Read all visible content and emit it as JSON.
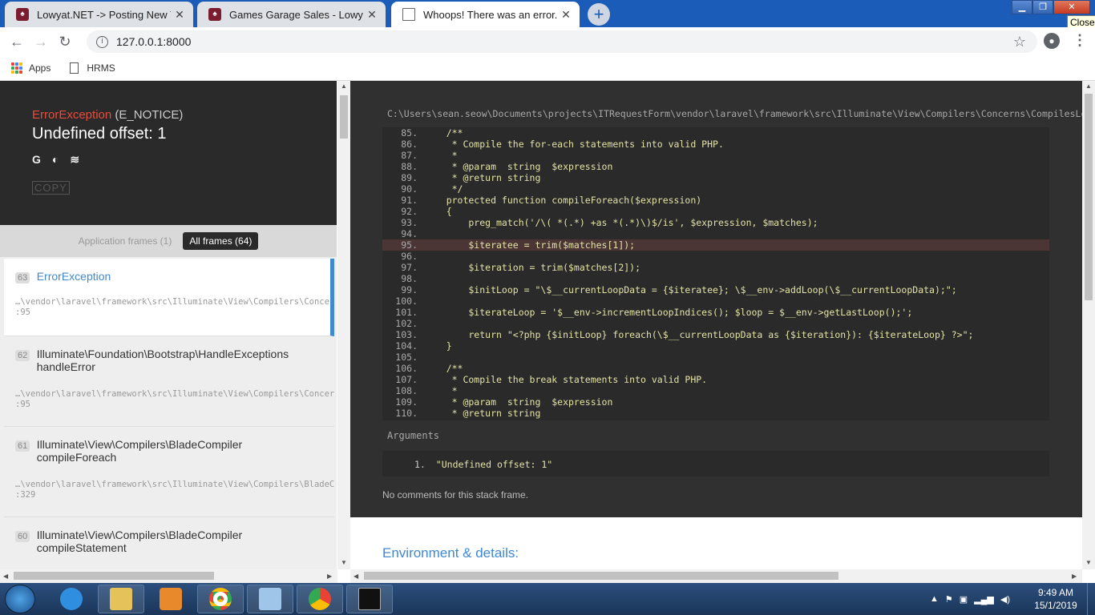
{
  "browser": {
    "tabs": [
      {
        "title": "Lowyat.NET -> Posting New Topi",
        "favicon": "lowyat-icon"
      },
      {
        "title": "Games Garage Sales - Lowyat.NE",
        "favicon": "lowyat-icon"
      },
      {
        "title": "Whoops! There was an error.",
        "favicon": "document-icon"
      }
    ],
    "close_tooltip": "Close",
    "address": "127.0.0.1:8000",
    "bookmarks": [
      {
        "label": "Apps",
        "icon": "apps-grid-icon"
      },
      {
        "label": "HRMS",
        "icon": "page-icon"
      }
    ]
  },
  "error": {
    "class": "ErrorException",
    "level": "(E_NOTICE)",
    "message": "Undefined offset: 1",
    "copy_label": "COPY",
    "filters": {
      "application": "Application frames (1)",
      "all": "All frames (64)"
    }
  },
  "frames": [
    {
      "num": "63",
      "class": "ErrorException",
      "method": "",
      "path": "…\\vendor\\laravel\\framework\\src\\Illuminate\\View\\Compilers\\Concerns\\CompilesLoops.php",
      "line": ":95"
    },
    {
      "num": "62",
      "class": "Illuminate\\Foundation\\Bootstrap\\HandleExceptions",
      "method": "handleError",
      "path": "…\\vendor\\laravel\\framework\\src\\Illuminate\\View\\Compilers\\Concerns\\CompilesLoops.php",
      "line": ":95"
    },
    {
      "num": "61",
      "class": "Illuminate\\View\\Compilers\\BladeCompiler",
      "method": "compileForeach",
      "path": "…\\vendor\\laravel\\framework\\src\\Illuminate\\View\\Compilers\\BladeCompiler.php",
      "line": ":329"
    },
    {
      "num": "60",
      "class": "Illuminate\\View\\Compilers\\BladeCompiler",
      "method": "compileStatement",
      "path": "",
      "line": ""
    }
  ],
  "source": {
    "file": "C:\\Users\\sean.seow\\Documents\\projects\\ITRequestForm\\vendor\\laravel\\framework\\src\\Illuminate\\View\\Compilers\\Concerns\\CompilesLoops.php",
    "highlight_line": "95.",
    "lines": [
      {
        "n": "85.",
        "code": "    /**"
      },
      {
        "n": "86.",
        "code": "     * Compile the for-each statements into valid PHP."
      },
      {
        "n": "87.",
        "code": "     *"
      },
      {
        "n": "88.",
        "code": "     * @param  string  $expression"
      },
      {
        "n": "89.",
        "code": "     * @return string"
      },
      {
        "n": "90.",
        "code": "     */"
      },
      {
        "n": "91.",
        "code": "    protected function compileForeach($expression)"
      },
      {
        "n": "92.",
        "code": "    {"
      },
      {
        "n": "93.",
        "code": "        preg_match('/\\( *(.*) +as *(.*)\\)$/is', $expression, $matches);"
      },
      {
        "n": "94.",
        "code": ""
      },
      {
        "n": "95.",
        "code": "        $iteratee = trim($matches[1]);"
      },
      {
        "n": "96.",
        "code": ""
      },
      {
        "n": "97.",
        "code": "        $iteration = trim($matches[2]);"
      },
      {
        "n": "98.",
        "code": ""
      },
      {
        "n": "99.",
        "code": "        $initLoop = \"\\$__currentLoopData = {$iteratee}; \\$__env->addLoop(\\$__currentLoopData);\";"
      },
      {
        "n": "100.",
        "code": ""
      },
      {
        "n": "101.",
        "code": "        $iterateLoop = '$__env->incrementLoopIndices(); $loop = $__env->getLastLoop();';"
      },
      {
        "n": "102.",
        "code": ""
      },
      {
        "n": "103.",
        "code": "        return \"<?php {$initLoop} foreach(\\$__currentLoopData as {$iteration}): {$iterateLoop} ?>\";"
      },
      {
        "n": "104.",
        "code": "    }"
      },
      {
        "n": "105.",
        "code": ""
      },
      {
        "n": "106.",
        "code": "    /**"
      },
      {
        "n": "107.",
        "code": "     * Compile the break statements into valid PHP."
      },
      {
        "n": "108.",
        "code": "     *"
      },
      {
        "n": "109.",
        "code": "     * @param  string  $expression"
      },
      {
        "n": "110.",
        "code": "     * @return string"
      }
    ]
  },
  "arguments": {
    "label": "Arguments",
    "items": [
      {
        "n": "1.",
        "value": "\"Undefined offset: 1\""
      }
    ]
  },
  "no_comments": "No comments for this stack frame.",
  "env_heading": "Environment & details:",
  "taskbar": {
    "time": "9:49 AM",
    "date": "15/1/2019",
    "apps": [
      "internet-explorer-icon",
      "file-explorer-icon",
      "media-player-icon",
      "chrome-icon",
      "notepad-icon",
      "chrome-icon",
      "command-prompt-icon"
    ]
  }
}
